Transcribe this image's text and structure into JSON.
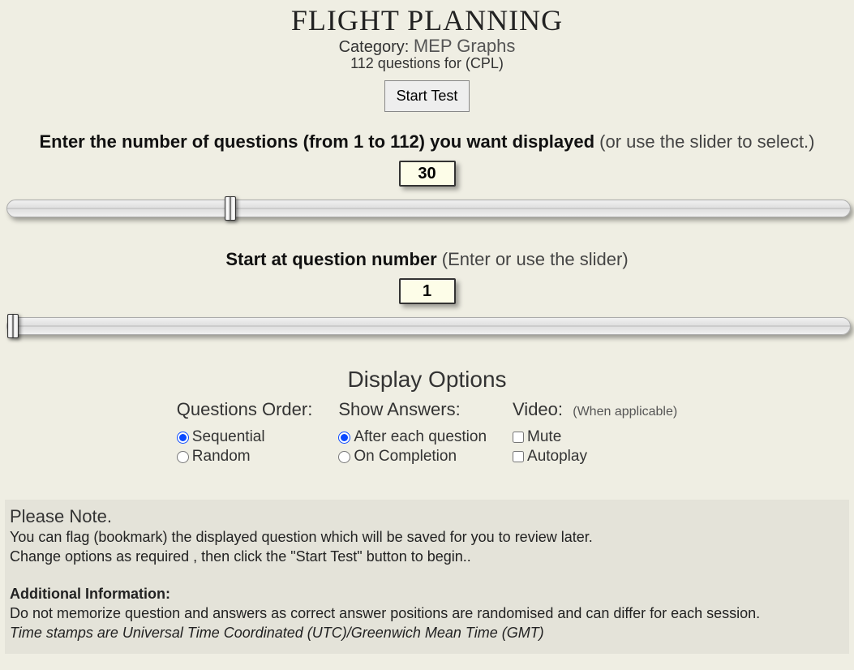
{
  "header": {
    "title": "FLIGHT PLANNING",
    "category_label": "Category:",
    "category_value": "MEP Graphs",
    "count_line": "112 questions for (CPL)",
    "start_button": "Start Test"
  },
  "questions": {
    "prompt_bold": "Enter the number of questions (from 1 to 112) you want displayed",
    "prompt_light": " (or use the slider to select.)",
    "value": "30",
    "min": 1,
    "max": 112
  },
  "start_at": {
    "prompt_bold": "Start at question number",
    "prompt_light": " (Enter or use the slider)",
    "value": "1",
    "min": 1,
    "max": 112
  },
  "display_options": {
    "heading": "Display Options",
    "order": {
      "heading": "Questions Order:",
      "sequential": "Sequential",
      "random": "Random",
      "selected": "sequential"
    },
    "answers": {
      "heading": "Show Answers:",
      "after_each": "After each question",
      "on_completion": "On Completion",
      "selected": "after_each"
    },
    "video": {
      "heading": "Video:",
      "sub": "(When applicable)",
      "mute": "Mute",
      "autoplay": "Autoplay"
    }
  },
  "note": {
    "heading": "Please Note.",
    "line1": "You can flag (bookmark) the displayed question which will be saved for you to review later.",
    "line2": "Change options as required , then click the \"Start Test\" button to begin..",
    "addl_heading": "Additional Information:",
    "addl_line1": "Do not memorize question and answers as correct answer positions are randomised and can differ for each session.",
    "addl_line2": "Time stamps are Universal Time Coordinated (UTC)/Greenwich Mean Time (GMT)"
  }
}
